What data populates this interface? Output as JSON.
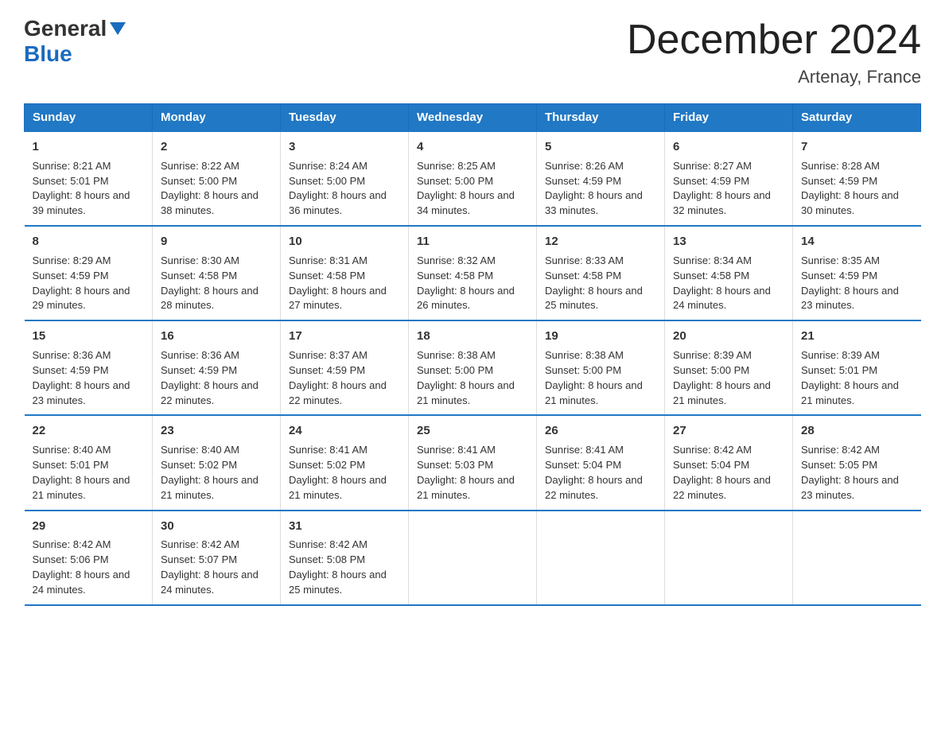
{
  "header": {
    "logo_general": "General",
    "logo_blue": "Blue",
    "month_title": "December 2024",
    "location": "Artenay, France"
  },
  "weekdays": [
    "Sunday",
    "Monday",
    "Tuesday",
    "Wednesday",
    "Thursday",
    "Friday",
    "Saturday"
  ],
  "weeks": [
    [
      {
        "day": "1",
        "sunrise": "8:21 AM",
        "sunset": "5:01 PM",
        "daylight": "8 hours and 39 minutes."
      },
      {
        "day": "2",
        "sunrise": "8:22 AM",
        "sunset": "5:00 PM",
        "daylight": "8 hours and 38 minutes."
      },
      {
        "day": "3",
        "sunrise": "8:24 AM",
        "sunset": "5:00 PM",
        "daylight": "8 hours and 36 minutes."
      },
      {
        "day": "4",
        "sunrise": "8:25 AM",
        "sunset": "5:00 PM",
        "daylight": "8 hours and 34 minutes."
      },
      {
        "day": "5",
        "sunrise": "8:26 AM",
        "sunset": "4:59 PM",
        "daylight": "8 hours and 33 minutes."
      },
      {
        "day": "6",
        "sunrise": "8:27 AM",
        "sunset": "4:59 PM",
        "daylight": "8 hours and 32 minutes."
      },
      {
        "day": "7",
        "sunrise": "8:28 AM",
        "sunset": "4:59 PM",
        "daylight": "8 hours and 30 minutes."
      }
    ],
    [
      {
        "day": "8",
        "sunrise": "8:29 AM",
        "sunset": "4:59 PM",
        "daylight": "8 hours and 29 minutes."
      },
      {
        "day": "9",
        "sunrise": "8:30 AM",
        "sunset": "4:58 PM",
        "daylight": "8 hours and 28 minutes."
      },
      {
        "day": "10",
        "sunrise": "8:31 AM",
        "sunset": "4:58 PM",
        "daylight": "8 hours and 27 minutes."
      },
      {
        "day": "11",
        "sunrise": "8:32 AM",
        "sunset": "4:58 PM",
        "daylight": "8 hours and 26 minutes."
      },
      {
        "day": "12",
        "sunrise": "8:33 AM",
        "sunset": "4:58 PM",
        "daylight": "8 hours and 25 minutes."
      },
      {
        "day": "13",
        "sunrise": "8:34 AM",
        "sunset": "4:58 PM",
        "daylight": "8 hours and 24 minutes."
      },
      {
        "day": "14",
        "sunrise": "8:35 AM",
        "sunset": "4:59 PM",
        "daylight": "8 hours and 23 minutes."
      }
    ],
    [
      {
        "day": "15",
        "sunrise": "8:36 AM",
        "sunset": "4:59 PM",
        "daylight": "8 hours and 23 minutes."
      },
      {
        "day": "16",
        "sunrise": "8:36 AM",
        "sunset": "4:59 PM",
        "daylight": "8 hours and 22 minutes."
      },
      {
        "day": "17",
        "sunrise": "8:37 AM",
        "sunset": "4:59 PM",
        "daylight": "8 hours and 22 minutes."
      },
      {
        "day": "18",
        "sunrise": "8:38 AM",
        "sunset": "5:00 PM",
        "daylight": "8 hours and 21 minutes."
      },
      {
        "day": "19",
        "sunrise": "8:38 AM",
        "sunset": "5:00 PM",
        "daylight": "8 hours and 21 minutes."
      },
      {
        "day": "20",
        "sunrise": "8:39 AM",
        "sunset": "5:00 PM",
        "daylight": "8 hours and 21 minutes."
      },
      {
        "day": "21",
        "sunrise": "8:39 AM",
        "sunset": "5:01 PM",
        "daylight": "8 hours and 21 minutes."
      }
    ],
    [
      {
        "day": "22",
        "sunrise": "8:40 AM",
        "sunset": "5:01 PM",
        "daylight": "8 hours and 21 minutes."
      },
      {
        "day": "23",
        "sunrise": "8:40 AM",
        "sunset": "5:02 PM",
        "daylight": "8 hours and 21 minutes."
      },
      {
        "day": "24",
        "sunrise": "8:41 AM",
        "sunset": "5:02 PM",
        "daylight": "8 hours and 21 minutes."
      },
      {
        "day": "25",
        "sunrise": "8:41 AM",
        "sunset": "5:03 PM",
        "daylight": "8 hours and 21 minutes."
      },
      {
        "day": "26",
        "sunrise": "8:41 AM",
        "sunset": "5:04 PM",
        "daylight": "8 hours and 22 minutes."
      },
      {
        "day": "27",
        "sunrise": "8:42 AM",
        "sunset": "5:04 PM",
        "daylight": "8 hours and 22 minutes."
      },
      {
        "day": "28",
        "sunrise": "8:42 AM",
        "sunset": "5:05 PM",
        "daylight": "8 hours and 23 minutes."
      }
    ],
    [
      {
        "day": "29",
        "sunrise": "8:42 AM",
        "sunset": "5:06 PM",
        "daylight": "8 hours and 24 minutes."
      },
      {
        "day": "30",
        "sunrise": "8:42 AM",
        "sunset": "5:07 PM",
        "daylight": "8 hours and 24 minutes."
      },
      {
        "day": "31",
        "sunrise": "8:42 AM",
        "sunset": "5:08 PM",
        "daylight": "8 hours and 25 minutes."
      },
      null,
      null,
      null,
      null
    ]
  ],
  "labels": {
    "sunrise": "Sunrise:",
    "sunset": "Sunset:",
    "daylight": "Daylight:"
  }
}
